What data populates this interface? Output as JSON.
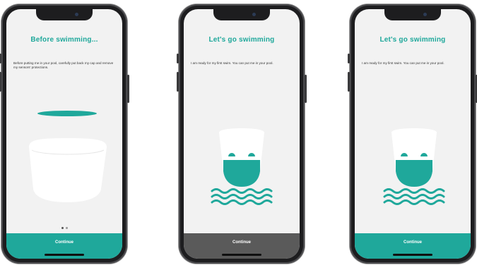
{
  "colors": {
    "accent": "#1fa89b",
    "continue_gray": "#5a5a5a",
    "screen_bg": "#f2f2f2",
    "phone_body": "#1d1d1f"
  },
  "screens": [
    {
      "title": "Before swimming...",
      "body": "Before putting me in your pool, carefully put back my cap and remove my sensors' protections.",
      "button_label": "Continue",
      "button_style": "teal",
      "pagination": {
        "count": 2,
        "active": 1
      },
      "illustration": "cap-and-sensor-cup-icon"
    },
    {
      "title": "Let's go swimming",
      "body": "I am ready for my first swim. You can put me in your pool.",
      "button_label": "Continue",
      "button_style": "gray",
      "illustration": "floating-cup-with-waves-icon"
    },
    {
      "title": "Let's go swimming",
      "body": "I am ready for my first swim. You can put me in your pool.",
      "button_label": "Continue",
      "button_style": "teal",
      "illustration": "floating-cup-with-waves-icon"
    }
  ]
}
